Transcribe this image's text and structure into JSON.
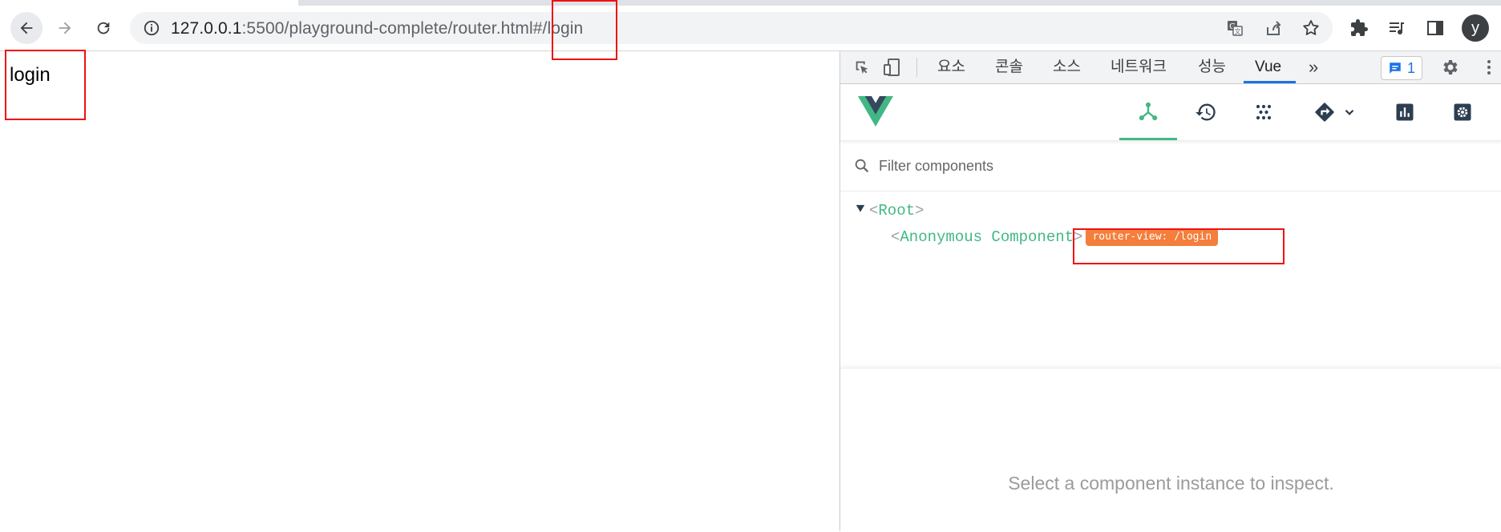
{
  "browser": {
    "url_host": "127.0.0.1",
    "url_path": ":5500/playground-complete/router.html#/login",
    "avatar_letter": "y",
    "icons": {
      "back": "back-arrow-icon",
      "forward": "forward-arrow-icon",
      "reload": "reload-icon",
      "site_info": "info-icon",
      "translate": "translate-icon",
      "share": "share-icon",
      "bookmark": "star-icon",
      "extensions": "puzzle-icon",
      "media": "media-queue-icon",
      "side_panel": "side-panel-icon"
    }
  },
  "page": {
    "heading": "login"
  },
  "devtools": {
    "tabs": [
      {
        "label": "요소"
      },
      {
        "label": "콘솔"
      },
      {
        "label": "소스"
      },
      {
        "label": "네트워크"
      },
      {
        "label": "성능"
      },
      {
        "label": "Vue",
        "active": true
      }
    ],
    "more_tabs": "»",
    "issues_count": "1"
  },
  "vue": {
    "filter_placeholder": "Filter components",
    "tree": {
      "root": {
        "open": "<",
        "name": "Root",
        "close": ">"
      },
      "child": {
        "open": "<",
        "name": "Anonymous Component",
        "close": ">",
        "badge": "router-view: /login"
      }
    },
    "inspect_message": "Select a component instance to inspect.",
    "accent_color": "#42b883",
    "badge_color": "#f47e3b"
  },
  "annotation_color": "#ee1111"
}
